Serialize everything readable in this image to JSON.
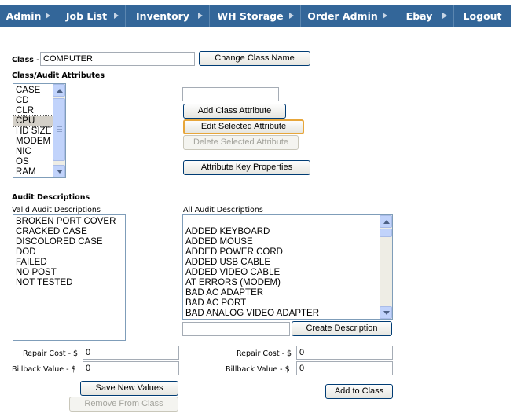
{
  "nav": {
    "items": [
      "Admin",
      "Job List",
      "Inventory",
      "WH Storage",
      "Order Admin",
      "Ebay",
      "Logout"
    ]
  },
  "class_section": {
    "label": "Class -",
    "value": "COMPUTER",
    "change_button": "Change Class Name"
  },
  "attributes": {
    "heading": "Class/Audit Attributes",
    "list": [
      "CASE",
      "CD",
      "CLR",
      "CPU",
      "HD SIZE",
      "MODEM",
      "NIC",
      "OS",
      "RAM"
    ],
    "selected": "CPU",
    "new_attribute_value": "",
    "add_button": "Add Class Attribute",
    "edit_button": "Edit Selected Attribute",
    "delete_button": "Delete Selected Attribute",
    "key_props_button": "Attribute Key Properties"
  },
  "audit": {
    "heading": "Audit Descriptions",
    "valid_label": "Valid Audit Descriptions",
    "valid_list": [
      "BROKEN PORT COVER",
      "CRACKED CASE",
      "DISCOLORED CASE",
      "DOD",
      "FAILED",
      "NO POST",
      "NOT TESTED"
    ],
    "all_label": "All Audit Descriptions",
    "all_list": [
      "",
      "ADDED KEYBOARD",
      "ADDED MOUSE",
      "ADDED POWER CORD",
      "ADDED USB CABLE",
      "ADDED VIDEO CABLE",
      "AT ERRORS (MODEM)",
      "BAD AC ADAPTER",
      "BAD AC PORT",
      "BAD ANALOG VIDEO ADAPTER"
    ],
    "new_description_value": "",
    "create_button": "Create Description"
  },
  "left_values": {
    "repair_label": "Repair Cost - $",
    "repair_value": "0",
    "billback_label": "Billback Value - $",
    "billback_value": "0",
    "save_button": "Save New Values",
    "remove_button": "Remove From Class"
  },
  "right_values": {
    "repair_label": "Repair Cost - $",
    "repair_value": "0",
    "billback_label": "Billback Value - $",
    "billback_value": "0",
    "add_button": "Add to Class"
  }
}
